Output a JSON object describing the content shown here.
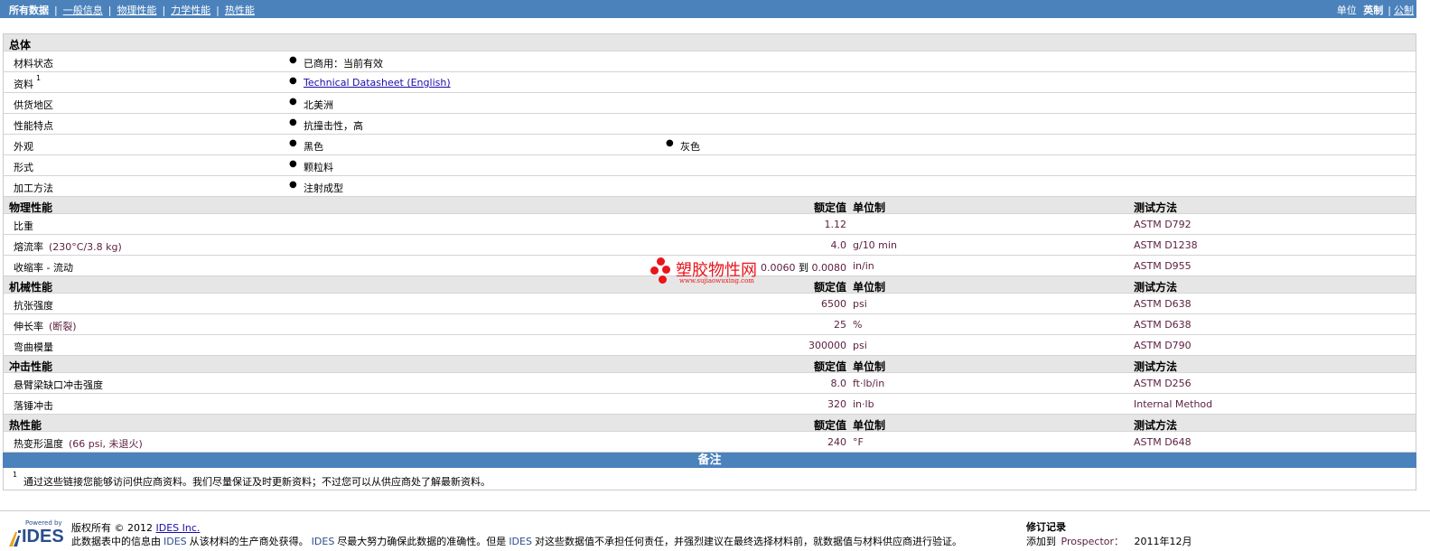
{
  "topnav": {
    "tabs": [
      "所有数据",
      "一般信息",
      "物理性能",
      "力学性能",
      "热性能"
    ],
    "unit_label": "单位",
    "unit_english": "英制",
    "unit_metric": "公制"
  },
  "general": {
    "section_title": "总体",
    "rows": [
      {
        "label": "材料状态",
        "value": "已商用：当前有效"
      },
      {
        "label": "资料",
        "sup": "1",
        "value": "Technical Datasheet (English)"
      },
      {
        "label": "供货地区",
        "value": "北美洲"
      },
      {
        "label": "性能特点",
        "value": "抗撞击性，高"
      },
      {
        "label": "外观",
        "value": "黑色",
        "value2": "灰色"
      },
      {
        "label": "形式",
        "value": "颗粒料"
      },
      {
        "label": "加工方法",
        "value": "注射成型"
      }
    ]
  },
  "headers": {
    "nominal": "额定值",
    "unit": "单位制",
    "test": "测试方法"
  },
  "physical": {
    "section_title": "物理性能",
    "rows": [
      {
        "label": "比重",
        "cond": "",
        "value": "1.12",
        "unit": "",
        "test": "ASTM D792"
      },
      {
        "label": "熔流率",
        "cond": "(230°C/3.8 kg)",
        "value": "4.0",
        "unit": "g/10 min",
        "test": "ASTM D1238"
      },
      {
        "label": "收缩率 - 流动",
        "cond": "",
        "value_from": "0.0060",
        "to": "到",
        "value_to": "0.0080",
        "unit": "in/in",
        "test": "ASTM D955"
      }
    ]
  },
  "mechanical": {
    "section_title": "机械性能",
    "rows": [
      {
        "label": "抗张强度",
        "cond": "",
        "value": "6500",
        "unit": "psi",
        "test": "ASTM D638"
      },
      {
        "label": "伸长率",
        "cond": "(断裂)",
        "value": "25",
        "unit": "%",
        "test": "ASTM D638"
      },
      {
        "label": "弯曲模量",
        "cond": "",
        "value": "300000",
        "unit": "psi",
        "test": "ASTM D790"
      }
    ]
  },
  "impact": {
    "section_title": "冲击性能",
    "rows": [
      {
        "label": "悬臂梁缺口冲击强度",
        "cond": "",
        "value": "8.0",
        "unit": "ft·lb/in",
        "test": "ASTM D256"
      },
      {
        "label": "落锤冲击",
        "cond": "",
        "value": "320",
        "unit": "in·lb",
        "test": "Internal Method"
      }
    ]
  },
  "thermal": {
    "section_title": "热性能",
    "rows": [
      {
        "label": "热变形温度",
        "cond": "(66 psi, 未退火)",
        "value": "240",
        "unit": "°F",
        "test": "ASTM D648"
      }
    ]
  },
  "watermark": {
    "title": "塑胶物性网",
    "url": "www.sujiaowuxing.com"
  },
  "notes": {
    "title": "备注",
    "sup": "1",
    "text": "通过这些链接您能够访问供应商资料。我们尽量保证及时更新资料；不过您可以从供应商处了解最新资料。"
  },
  "footer": {
    "logo_powered": "Powered by",
    "logo_name": "IDES",
    "copyright_prefix": "版权所有 © 2012",
    "copyright_link": "IDES Inc.",
    "disclaimer_1": "此数据表中的信息由",
    "disclaimer_ides1": "IDES",
    "disclaimer_2": "从该材料的生产商处获得。",
    "disclaimer_ides2": "IDES",
    "disclaimer_3": "尽最大努力确保此数据的准确性。但是",
    "disclaimer_ides3": "IDES",
    "disclaimer_4": "对这些数据值不承担任何责任，并强烈建议在最终选择材料前，就数据值与材料供应商进行验证。",
    "rev_title": "修订记录",
    "rev_added": "添加到",
    "rev_prospector": "Prospector：",
    "rev_date": "2011年12月"
  },
  "colors": {
    "nav": "#4b82bc",
    "section": "#e6e6e6",
    "value_text": "#5d2140",
    "watermark": "#e8151b"
  }
}
